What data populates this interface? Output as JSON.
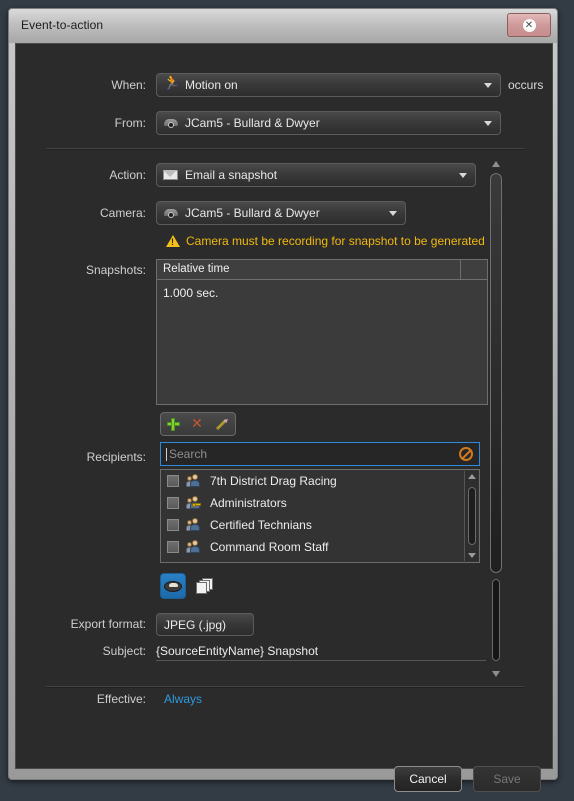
{
  "window": {
    "title": "Event-to-action",
    "close_glyph": "✕"
  },
  "trigger_section": {
    "when_label": "When:",
    "when_value": "Motion on",
    "when_icon": "motion-running-icon",
    "occurs_text": "occurs",
    "from_label": "From:",
    "from_value": "JCam5 - Bullard & Dwyer",
    "from_icon": "dome-camera-icon"
  },
  "action_section": {
    "action_label": "Action:",
    "action_value": "Email a snapshot",
    "action_icon": "envelope-icon",
    "camera_label": "Camera:",
    "camera_value": "JCam5 - Bullard & Dwyer",
    "camera_icon": "dome-camera-icon",
    "warning_icon": "warning-triangle-icon",
    "warning_text": "Camera must be recording for snapshot to be generated",
    "warning_color": "#f0b90f"
  },
  "snapshots": {
    "label": "Snapshots:",
    "columns": [
      "Relative time",
      ""
    ],
    "rows": [
      {
        "relative_time": "1.000 sec."
      }
    ],
    "toolbar": {
      "add": "add-icon",
      "delete": "delete-icon",
      "edit": "edit-icon"
    }
  },
  "recipients": {
    "label": "Recipients:",
    "search_placeholder": "Search",
    "search_value": "",
    "clear_icon": "clear-search-icon",
    "items": [
      {
        "name": "7th District Drag Racing",
        "checked": false,
        "icon": "user-group-icon"
      },
      {
        "name": "Administrators",
        "checked": false,
        "icon": "admin-group-icon"
      },
      {
        "name": "Certified Technians",
        "checked": false,
        "icon": "user-group-icon"
      },
      {
        "name": "Command Room Staff",
        "checked": false,
        "icon": "user-group-icon"
      }
    ],
    "mode_buttons": [
      {
        "icon": "to-recipient-icon",
        "active": true
      },
      {
        "icon": "cc-copy-icon",
        "active": false
      }
    ]
  },
  "export": {
    "format_label": "Export format:",
    "format_value": "JPEG (.jpg)",
    "subject_label": "Subject:",
    "subject_value": "{SourceEntityName} Snapshot"
  },
  "effective": {
    "label": "Effective:",
    "value": "Always",
    "value_color": "#2f9ae0"
  },
  "footer": {
    "cancel_label": "Cancel",
    "save_label": "Save"
  }
}
